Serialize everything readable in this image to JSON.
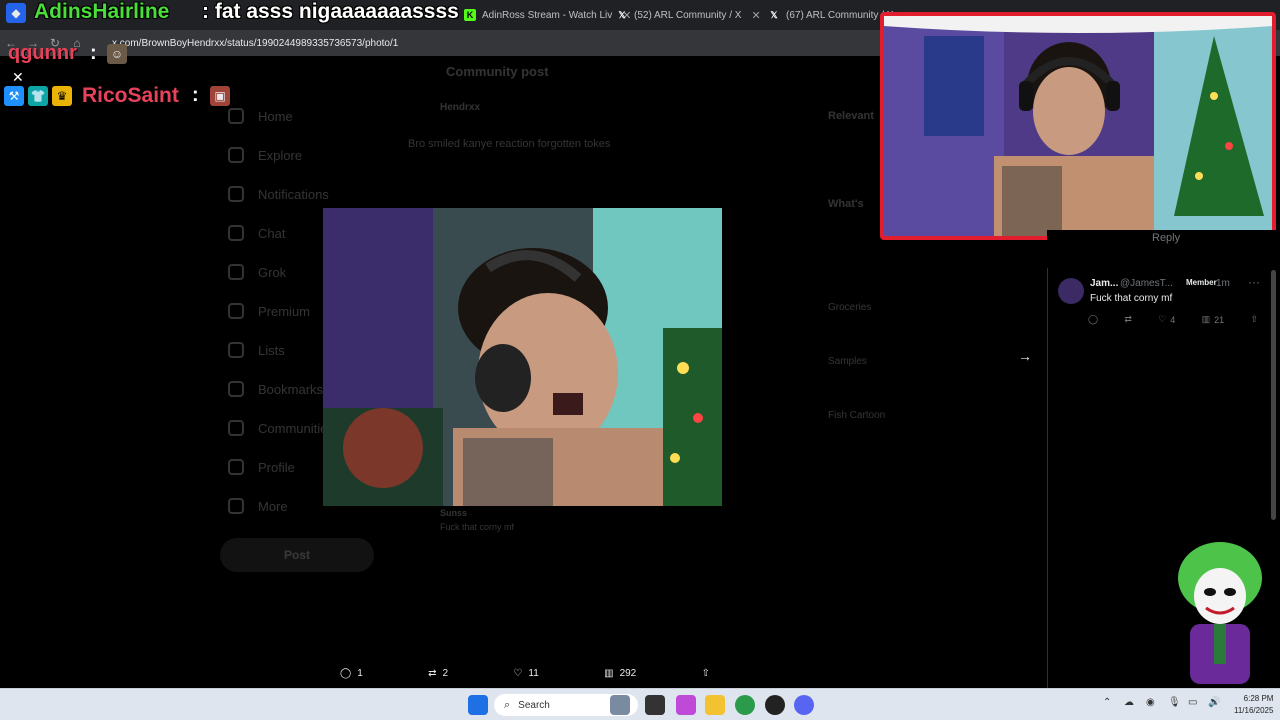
{
  "browser": {
    "tabs": [
      {
        "label": "AdinRoss Stream - Watch Liv",
        "icon": "kick-icon"
      },
      {
        "label": "(52) ARL Community / X",
        "icon": "x-icon"
      },
      {
        "label": "(67) ARL Community / X",
        "icon": "x-icon"
      }
    ],
    "url": "x.com/BrownBoyHendrxx/status/1990244989335736573/photo/1"
  },
  "stream_overlay": {
    "title_user": "AdinsHairline",
    "title_message": ": fat asss nigaaaaaaassss",
    "chat": [
      {
        "user": "qgunnr",
        "colon": ":"
      },
      {
        "user": "RicoSaint",
        "colon": ":"
      }
    ]
  },
  "background": {
    "nav": [
      "Home",
      "Explore",
      "Notifications",
      "Chat",
      "Grok",
      "Premium",
      "Lists",
      "Bookmarks",
      "Communities",
      "Profile",
      "More"
    ],
    "post_button": "Post",
    "header_title": "Community post",
    "post_user": "Hendrxx",
    "post_text": "Bro smiled kanye reaction forgotten tokes",
    "right_heading": "Relevant",
    "whats_heading": "What's",
    "right_items": [
      "Groceries",
      "Samples",
      "Fish Cartoon"
    ],
    "reply_preview_user": "Sunss",
    "reply_preview_text": "Fuck that corny mf"
  },
  "reply_panel": {
    "top_reply_label": "Reply",
    "reply": {
      "name": "Jam...",
      "handle": "@JamesT...",
      "badge": "Member",
      "time": "1m",
      "text": "Fuck that corny mf",
      "likes": "4",
      "views": "21"
    }
  },
  "photo_actions": {
    "replies": "1",
    "reposts": "2",
    "likes": "11",
    "views": "292"
  },
  "taskbar": {
    "search_label": "Search",
    "time": "6:28 PM",
    "date": "11/16/2025"
  },
  "colors": {
    "overlay_green": "#4ade3a",
    "overlay_red": "#e8425b",
    "webcam_border": "#e11d2e"
  }
}
